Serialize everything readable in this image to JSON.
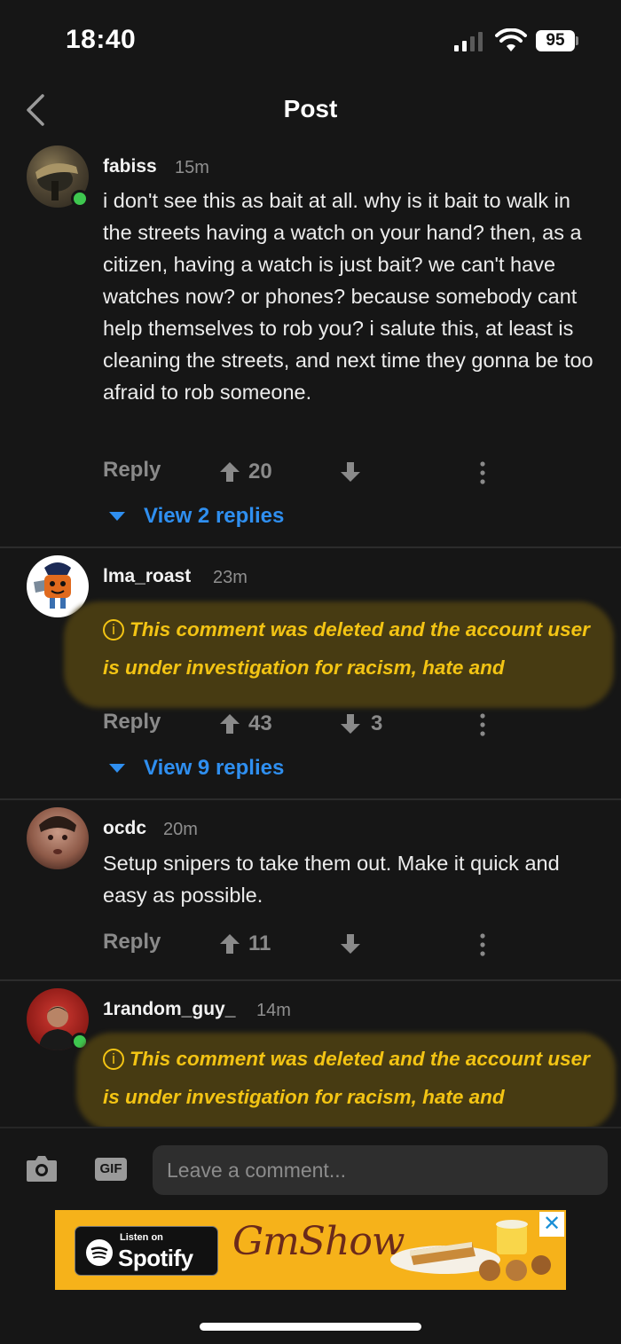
{
  "status_bar": {
    "time": "18:40",
    "battery": "95"
  },
  "nav": {
    "title": "Post"
  },
  "comments": [
    {
      "username": "fabiss",
      "time": "15m",
      "text": "i don't see this as bait at all. why is it bait to walk in the streets having a watch on your hand? then, as a citizen, having a watch is just bait? we can't have watches now? or phones? because somebody cant help themselves to rob you? i salute this, at least is cleaning the streets, and next time they gonna be too afraid to rob someone.",
      "reply_label": "Reply",
      "upvotes": "20",
      "downvotes": "",
      "view_replies": "View 2 replies",
      "online": true
    },
    {
      "username": "lma_roast",
      "time": "23m",
      "deleted_text": "This comment was deleted and the account user is under investigation for racism, hate and",
      "info_glyph": "i",
      "reply_label": "Reply",
      "upvotes": "43",
      "downvotes": "3",
      "view_replies": "View 9 replies",
      "online": false
    },
    {
      "username": "ocdc",
      "time": "20m",
      "text": "Setup snipers to take them out. Make it quick and easy as possible.",
      "reply_label": "Reply",
      "upvotes": "11",
      "downvotes": "",
      "online": false
    },
    {
      "username": "1random_guy_",
      "time": "14m",
      "deleted_text": "This comment was deleted and the account user is under investigation for racism, hate and",
      "info_glyph": "i",
      "online": true
    }
  ],
  "input_bar": {
    "placeholder": "Leave a comment...",
    "gif_label": "GIF",
    "camera_icon": "camera-icon"
  },
  "ad": {
    "listen_on": "Listen on",
    "spotify": "Spotify",
    "brand": "GmShow",
    "close": "✕"
  },
  "colors": {
    "background": "#161616",
    "link_blue": "#2f8ff0",
    "deleted_yellow": "#f3c414",
    "online_green": "#3ec74f",
    "ad_background": "#f6b21a"
  }
}
